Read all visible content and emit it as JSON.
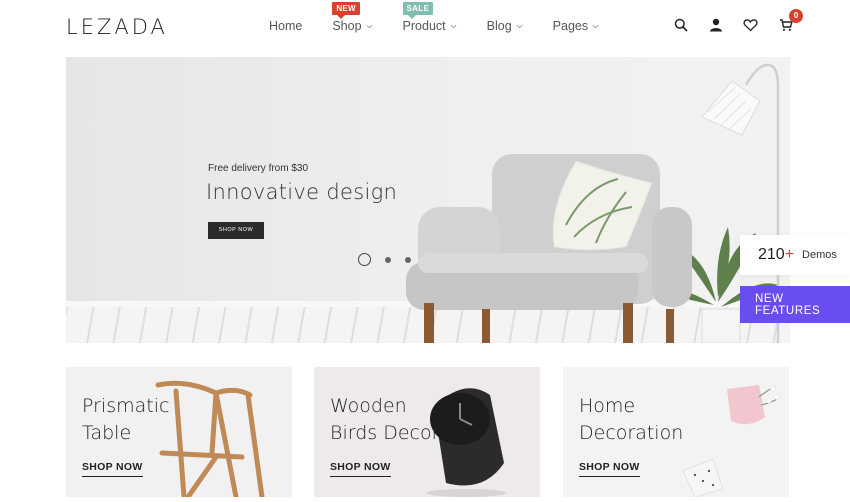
{
  "brand": {
    "logo": "LEZADA"
  },
  "nav": {
    "items": [
      {
        "label": "Home",
        "badge": "",
        "dropdown": false
      },
      {
        "label": "Shop",
        "badge": "NEW",
        "dropdown": true
      },
      {
        "label": "Product",
        "badge": "SALE",
        "dropdown": true
      },
      {
        "label": "Blog",
        "badge": "",
        "dropdown": true
      },
      {
        "label": "Pages",
        "badge": "",
        "dropdown": true
      }
    ]
  },
  "header_icons": {
    "search": "search-icon",
    "account": "user-icon",
    "wishlist": "heart-icon",
    "cart": "cart-icon",
    "cart_count": "0"
  },
  "hero": {
    "subtitle": "Free delivery from $30",
    "title": "Innovative design",
    "button": "SHOP NOW",
    "slides": 3,
    "active_slide": 1
  },
  "side": {
    "demos_count": "210",
    "demos_plus": "+",
    "demos_label": "Demos",
    "new_features": "NEW FEATURES"
  },
  "cards": [
    {
      "line1": "Prismatic",
      "line2": "Table",
      "link": "SHOP NOW"
    },
    {
      "line1": "Wooden",
      "line2": "Birds Decor",
      "link": "SHOP NOW"
    },
    {
      "line1": "Home",
      "line2": "Decoration",
      "link": "SHOP NOW"
    }
  ],
  "colors": {
    "accent_red": "#d9412f",
    "sale_teal": "#7fbfb3",
    "purple": "#6a4df0",
    "dark": "#222222"
  }
}
